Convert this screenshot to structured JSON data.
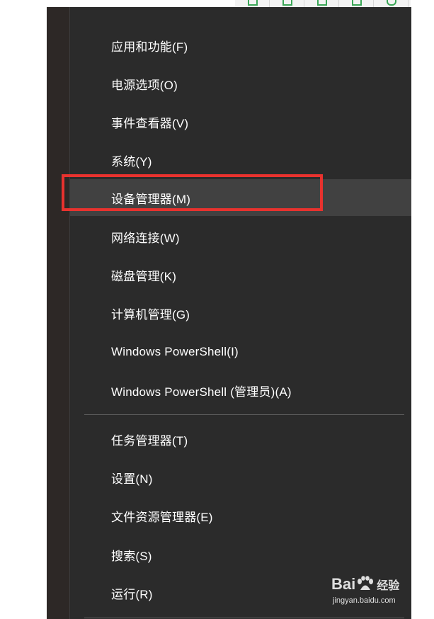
{
  "menu": {
    "items": [
      {
        "label": "应用和功能(F)"
      },
      {
        "label": "电源选项(O)"
      },
      {
        "label": "事件查看器(V)"
      },
      {
        "label": "系统(Y)"
      },
      {
        "label": "设备管理器(M)"
      },
      {
        "label": "网络连接(W)"
      },
      {
        "label": "磁盘管理(K)"
      },
      {
        "label": "计算机管理(G)"
      },
      {
        "label": "Windows PowerShell(I)"
      },
      {
        "label": "Windows PowerShell (管理员)(A)"
      },
      {
        "label": "任务管理器(T)"
      },
      {
        "label": "设置(N)"
      },
      {
        "label": "文件资源管理器(E)"
      },
      {
        "label": "搜索(S)"
      },
      {
        "label": "运行(R)"
      }
    ],
    "highlighted_item": "设备管理器(M)"
  },
  "watermark": {
    "brand_left": "Bai",
    "brand_right": "经验",
    "url": "jingyan.baidu.com",
    "paw_icon": "baidu-paw-icon"
  },
  "colors": {
    "menu_bg": "#2b2b2b",
    "menu_text": "#ffffff",
    "hover_bg": "#414141",
    "highlight": "#e8322e"
  }
}
